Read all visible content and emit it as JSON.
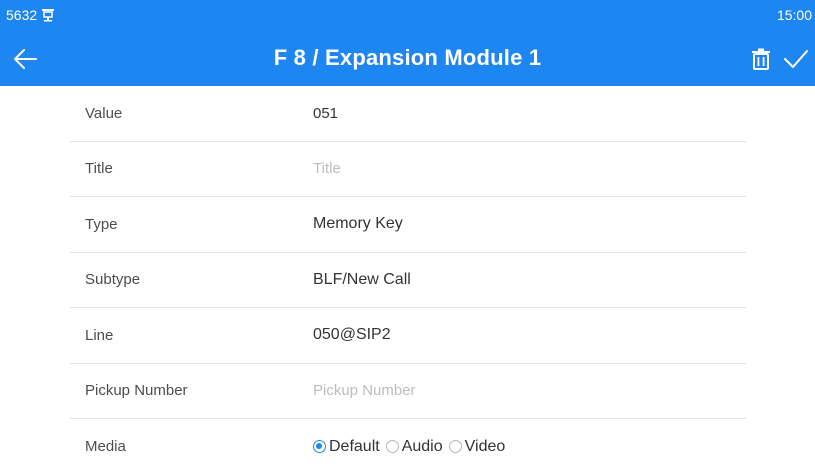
{
  "status_bar": {
    "left_text": "5632",
    "clock": "15:00",
    "status_icon": "network-icon"
  },
  "header": {
    "title": "F 8 / Expansion Module 1"
  },
  "form": {
    "value": {
      "label": "Value",
      "value": "051"
    },
    "title": {
      "label": "Title",
      "value": "",
      "placeholder": "Title"
    },
    "type": {
      "label": "Type",
      "value": "Memory Key"
    },
    "subtype": {
      "label": "Subtype",
      "value": "BLF/New Call"
    },
    "line": {
      "label": "Line",
      "value": "050@SIP2"
    },
    "pickup": {
      "label": "Pickup Number",
      "value": "",
      "placeholder": "Pickup Number"
    },
    "media": {
      "label": "Media",
      "options": [
        "Default",
        "Audio",
        "Video"
      ],
      "selected": "Default"
    }
  },
  "colors": {
    "accent": "#1e86f0",
    "divider": "#e3e3e3",
    "placeholder": "#bdbdbd"
  }
}
